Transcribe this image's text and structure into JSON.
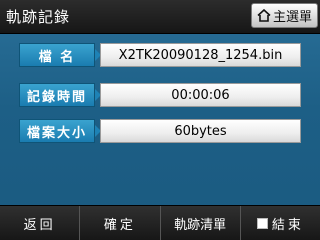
{
  "window": {
    "title": "軌跡記錄",
    "home_button_label": "主選單",
    "home_icon": "home-icon"
  },
  "fields": [
    {
      "label": "檔 名",
      "value": "X2TK20090128_1254.bin"
    },
    {
      "label": "記錄時間",
      "value": "00:00:06"
    },
    {
      "label": "檔案大小",
      "value": "60bytes"
    }
  ],
  "bottom_bar": {
    "back": "返回",
    "confirm": "確定",
    "clear": "軌跡清單",
    "end": "結束"
  },
  "colors": {
    "background": "#1d5f86",
    "label_bg": "#2a8fc2",
    "bar_bg": "#1e1e1e"
  }
}
